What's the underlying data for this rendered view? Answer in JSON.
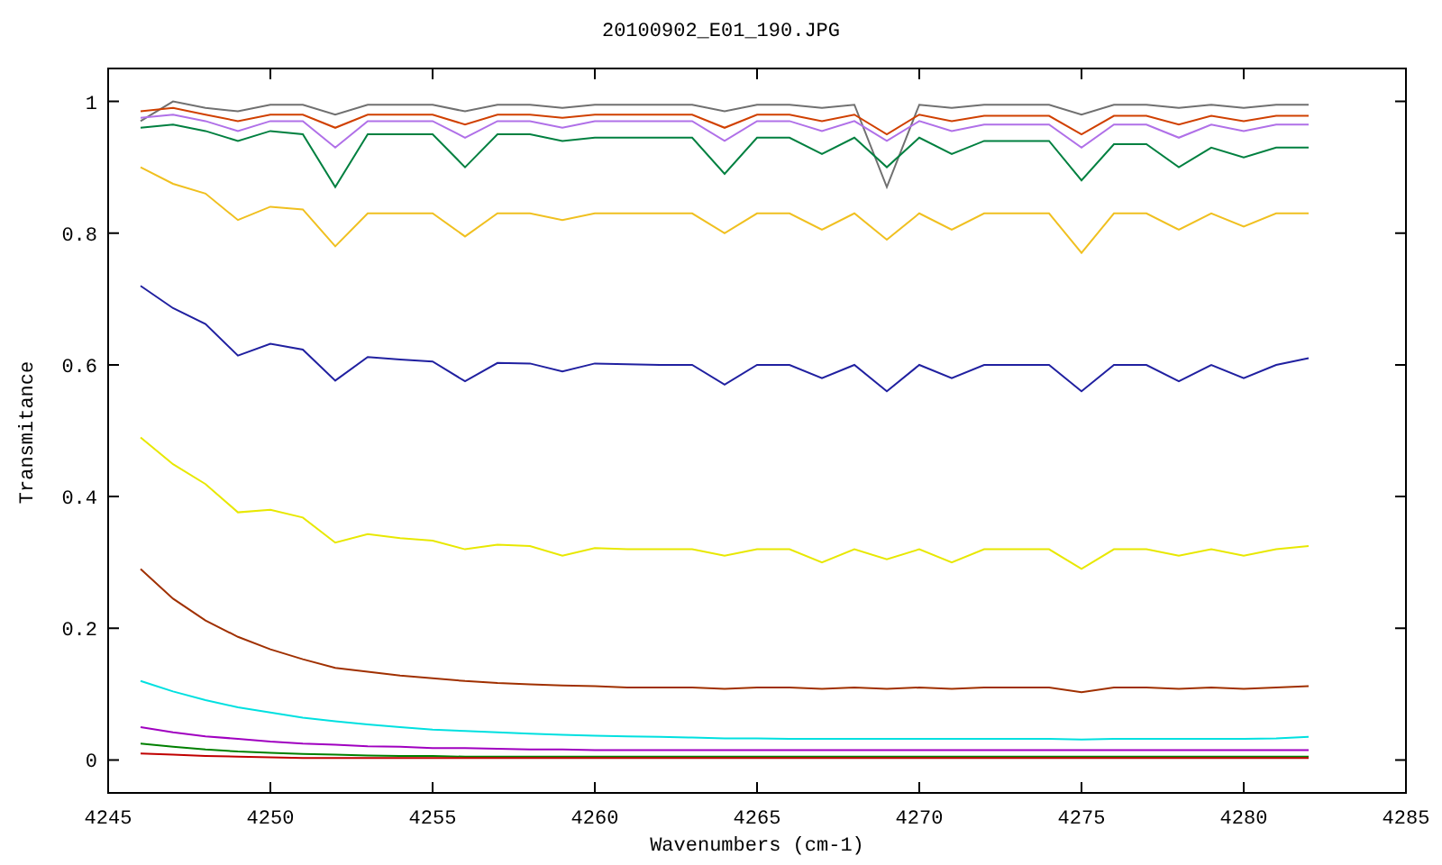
{
  "chart_data": {
    "type": "line",
    "title": "20100902_E01_190.JPG",
    "xlabel": "Wavenumbers (cm-1)",
    "ylabel": "Transmitance",
    "xlim": [
      4245,
      4285
    ],
    "ylim": [
      -0.05,
      1.05
    ],
    "xticks": [
      4245,
      4250,
      4255,
      4260,
      4265,
      4270,
      4275,
      4280,
      4285
    ],
    "yticks": [
      {
        "value": 0,
        "label": "0"
      },
      {
        "value": 0.2,
        "label": "0.2"
      },
      {
        "value": 0.4,
        "label": "0.4"
      },
      {
        "value": 0.6,
        "label": "0.6"
      },
      {
        "value": 0.8,
        "label": "0.8"
      },
      {
        "value": 1,
        "label": "1"
      }
    ],
    "x": [
      4246,
      4247,
      4248,
      4249,
      4250,
      4251,
      4252,
      4253,
      4254,
      4255,
      4256,
      4257,
      4258,
      4259,
      4260,
      4261,
      4262,
      4263,
      4264,
      4265,
      4266,
      4267,
      4268,
      4269,
      4270,
      4271,
      4272,
      4273,
      4274,
      4275,
      4276,
      4277,
      4278,
      4279,
      4280,
      4281,
      4282
    ],
    "series": [
      {
        "color": "#707070",
        "values": [
          0.97,
          1.0,
          0.99,
          0.985,
          0.995,
          0.995,
          0.98,
          0.995,
          0.995,
          0.995,
          0.985,
          0.995,
          0.995,
          0.99,
          0.995,
          0.995,
          0.995,
          0.995,
          0.985,
          0.995,
          0.995,
          0.99,
          0.995,
          0.87,
          0.995,
          0.99,
          0.995,
          0.995,
          0.995,
          0.98,
          0.995,
          0.995,
          0.99,
          0.995,
          0.99,
          0.995,
          0.995
        ]
      },
      {
        "color": "#d04000",
        "values": [
          0.985,
          0.99,
          0.98,
          0.97,
          0.98,
          0.98,
          0.96,
          0.98,
          0.98,
          0.98,
          0.965,
          0.98,
          0.98,
          0.975,
          0.98,
          0.98,
          0.98,
          0.98,
          0.96,
          0.98,
          0.98,
          0.97,
          0.98,
          0.95,
          0.98,
          0.97,
          0.978,
          0.978,
          0.978,
          0.95,
          0.978,
          0.978,
          0.965,
          0.978,
          0.97,
          0.978,
          0.978
        ]
      },
      {
        "color": "#b070e8",
        "values": [
          0.975,
          0.98,
          0.97,
          0.955,
          0.97,
          0.97,
          0.93,
          0.97,
          0.97,
          0.97,
          0.945,
          0.97,
          0.97,
          0.96,
          0.97,
          0.97,
          0.97,
          0.97,
          0.94,
          0.97,
          0.97,
          0.955,
          0.97,
          0.94,
          0.97,
          0.955,
          0.965,
          0.965,
          0.965,
          0.93,
          0.965,
          0.965,
          0.945,
          0.965,
          0.955,
          0.965,
          0.965
        ]
      },
      {
        "color": "#008040",
        "values": [
          0.96,
          0.965,
          0.955,
          0.94,
          0.955,
          0.95,
          0.87,
          0.95,
          0.95,
          0.95,
          0.9,
          0.95,
          0.95,
          0.94,
          0.945,
          0.945,
          0.945,
          0.945,
          0.89,
          0.945,
          0.945,
          0.92,
          0.945,
          0.9,
          0.945,
          0.92,
          0.94,
          0.94,
          0.94,
          0.88,
          0.935,
          0.935,
          0.9,
          0.93,
          0.915,
          0.93,
          0.93
        ]
      },
      {
        "color": "#f0c020",
        "values": [
          0.9,
          0.875,
          0.86,
          0.82,
          0.84,
          0.836,
          0.78,
          0.83,
          0.83,
          0.83,
          0.795,
          0.83,
          0.83,
          0.82,
          0.83,
          0.83,
          0.83,
          0.83,
          0.8,
          0.83,
          0.83,
          0.805,
          0.83,
          0.79,
          0.83,
          0.805,
          0.83,
          0.83,
          0.83,
          0.77,
          0.83,
          0.83,
          0.805,
          0.83,
          0.81,
          0.83,
          0.83
        ]
      },
      {
        "color": "#2020a0",
        "values": [
          0.72,
          0.686,
          0.662,
          0.614,
          0.632,
          0.623,
          0.576,
          0.612,
          0.608,
          0.605,
          0.575,
          0.603,
          0.602,
          0.59,
          0.602,
          0.601,
          0.6,
          0.6,
          0.57,
          0.6,
          0.6,
          0.58,
          0.6,
          0.56,
          0.6,
          0.58,
          0.6,
          0.6,
          0.6,
          0.56,
          0.6,
          0.6,
          0.575,
          0.6,
          0.58,
          0.6,
          0.61
        ]
      },
      {
        "color": "#e8e800",
        "values": [
          0.49,
          0.449,
          0.419,
          0.376,
          0.38,
          0.368,
          0.33,
          0.343,
          0.337,
          0.333,
          0.32,
          0.327,
          0.325,
          0.31,
          0.322,
          0.32,
          0.32,
          0.32,
          0.31,
          0.32,
          0.32,
          0.3,
          0.32,
          0.305,
          0.32,
          0.3,
          0.32,
          0.32,
          0.32,
          0.29,
          0.32,
          0.32,
          0.31,
          0.32,
          0.31,
          0.32,
          0.325
        ]
      },
      {
        "color": "#a03000",
        "values": [
          0.29,
          0.245,
          0.212,
          0.187,
          0.168,
          0.153,
          0.14,
          0.134,
          0.128,
          0.124,
          0.12,
          0.117,
          0.115,
          0.113,
          0.112,
          0.11,
          0.11,
          0.11,
          0.108,
          0.11,
          0.11,
          0.108,
          0.11,
          0.108,
          0.11,
          0.108,
          0.11,
          0.11,
          0.11,
          0.103,
          0.11,
          0.11,
          0.108,
          0.11,
          0.108,
          0.11,
          0.112
        ]
      },
      {
        "color": "#00e0e0",
        "values": [
          0.12,
          0.104,
          0.091,
          0.08,
          0.072,
          0.064,
          0.059,
          0.054,
          0.05,
          0.046,
          0.044,
          0.042,
          0.04,
          0.038,
          0.037,
          0.036,
          0.035,
          0.034,
          0.033,
          0.033,
          0.032,
          0.032,
          0.032,
          0.032,
          0.032,
          0.032,
          0.032,
          0.032,
          0.032,
          0.031,
          0.032,
          0.032,
          0.032,
          0.032,
          0.032,
          0.033,
          0.035
        ]
      },
      {
        "color": "#a000c0",
        "values": [
          0.05,
          0.042,
          0.036,
          0.032,
          0.028,
          0.025,
          0.023,
          0.021,
          0.02,
          0.018,
          0.018,
          0.017,
          0.016,
          0.016,
          0.015,
          0.015,
          0.015,
          0.015,
          0.015,
          0.015,
          0.015,
          0.015,
          0.015,
          0.015,
          0.015,
          0.015,
          0.015,
          0.015,
          0.015,
          0.015,
          0.015,
          0.015,
          0.015,
          0.015,
          0.015,
          0.015,
          0.015
        ]
      },
      {
        "color": "#008000",
        "values": [
          0.025,
          0.02,
          0.016,
          0.013,
          0.011,
          0.009,
          0.008,
          0.007,
          0.006,
          0.006,
          0.005,
          0.005,
          0.005,
          0.005,
          0.005,
          0.005,
          0.005,
          0.005,
          0.005,
          0.005,
          0.005,
          0.005,
          0.005,
          0.005,
          0.005,
          0.005,
          0.005,
          0.005,
          0.005,
          0.005,
          0.005,
          0.005,
          0.005,
          0.005,
          0.005,
          0.005,
          0.005
        ]
      },
      {
        "color": "#c00000",
        "values": [
          0.01,
          0.008,
          0.006,
          0.005,
          0.004,
          0.003,
          0.003,
          0.003,
          0.003,
          0.003,
          0.003,
          0.003,
          0.003,
          0.003,
          0.003,
          0.003,
          0.003,
          0.003,
          0.003,
          0.003,
          0.003,
          0.003,
          0.003,
          0.003,
          0.003,
          0.003,
          0.003,
          0.003,
          0.003,
          0.003,
          0.003,
          0.003,
          0.003,
          0.003,
          0.003,
          0.003,
          0.003
        ]
      }
    ]
  }
}
